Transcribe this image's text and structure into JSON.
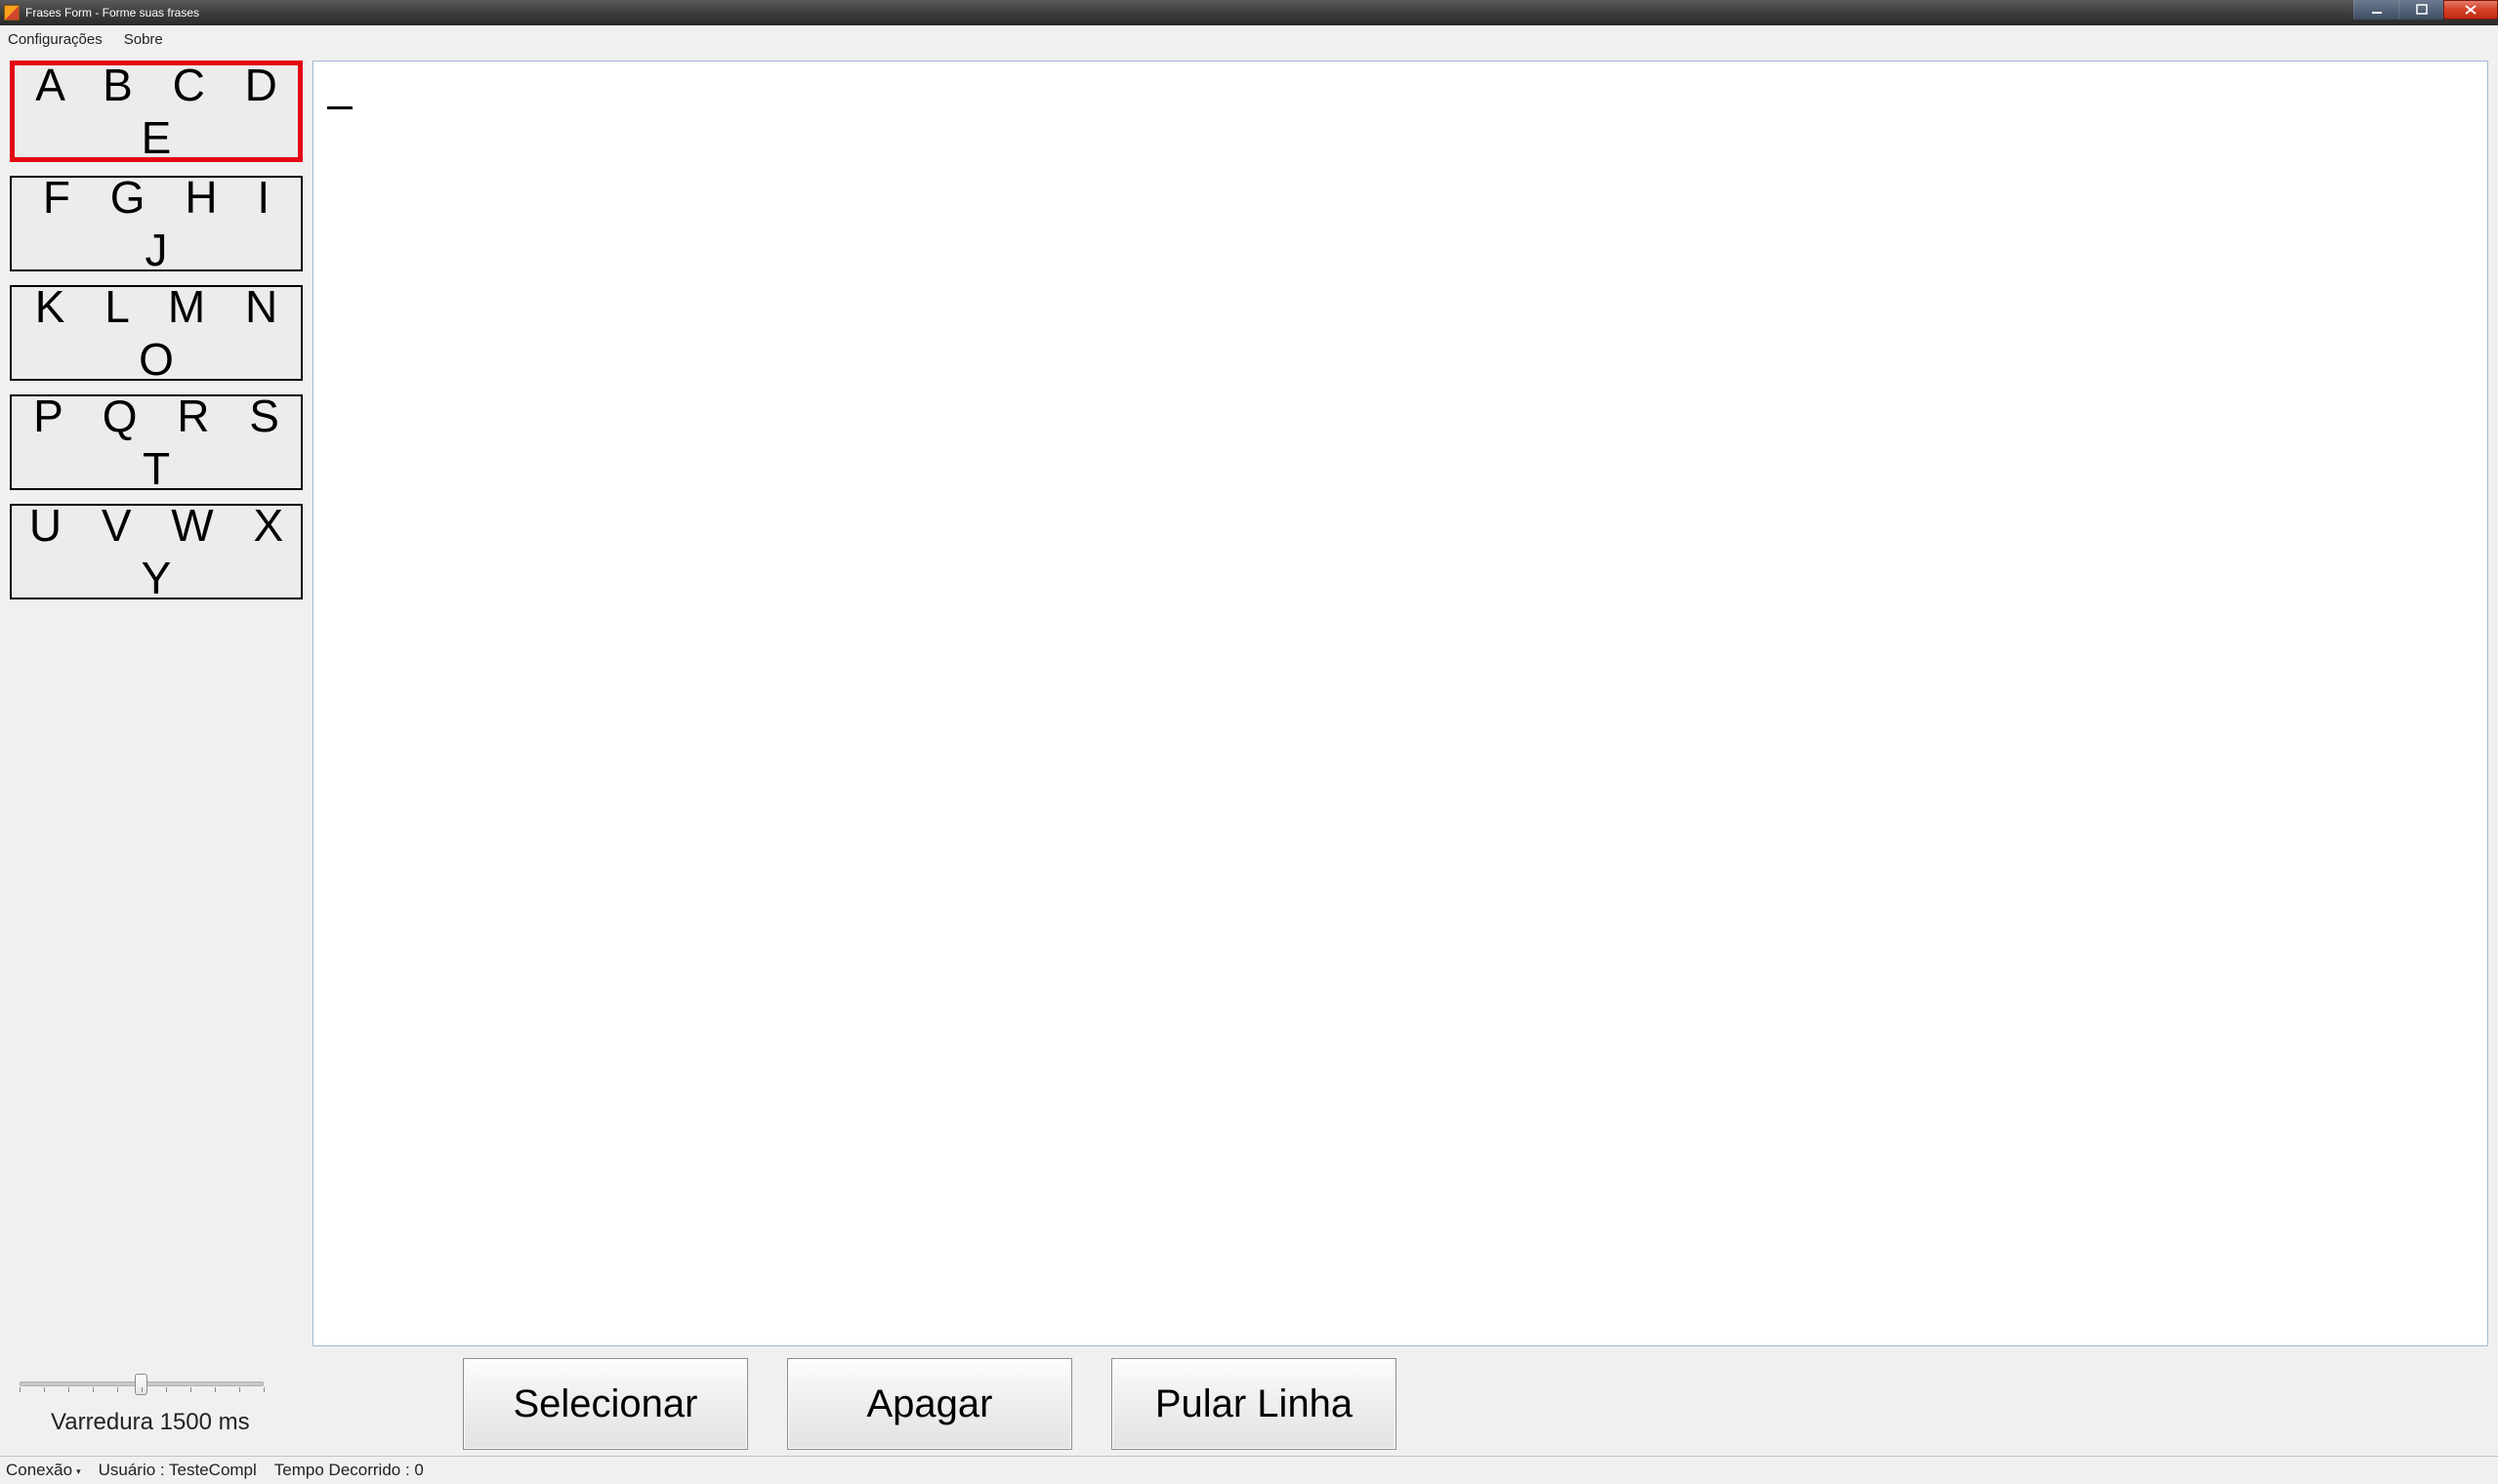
{
  "window": {
    "title": "Frases Form - Forme suas frases"
  },
  "menu": {
    "config": "Configurações",
    "about": "Sobre"
  },
  "letterGroups": {
    "g0": "A B C D E",
    "g1": "F G H I J",
    "g2": "K L M N O",
    "g3": "P Q R S T",
    "g4": "U V W X Y"
  },
  "textArea": {
    "content": ""
  },
  "slider": {
    "label": "Varredura 1500 ms"
  },
  "actions": {
    "select": "Selecionar",
    "erase": "Apagar",
    "newline": "Pular Linha"
  },
  "status": {
    "connection": "Conexão",
    "user": "Usuário : TesteCompl",
    "elapsed": "Tempo Decorrido : 0"
  }
}
